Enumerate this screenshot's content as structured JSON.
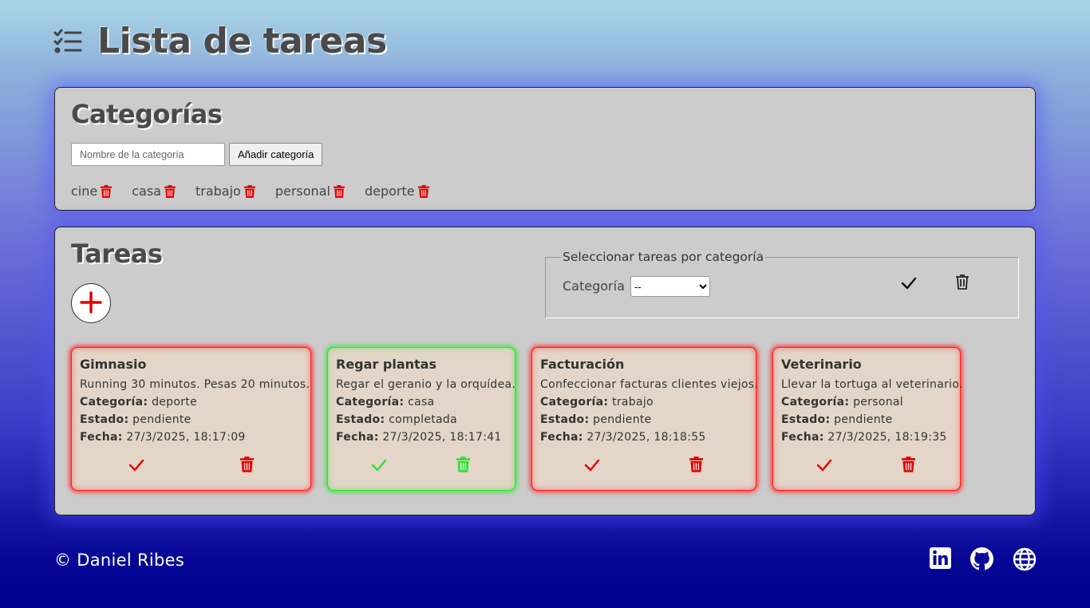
{
  "app": {
    "title": "Lista de tareas",
    "icon": "task-list-icon"
  },
  "categories_panel": {
    "title": "Categorías",
    "input_placeholder": "Nombre de la categoría",
    "add_button": "Añadir categoría",
    "items": [
      {
        "label": "cine"
      },
      {
        "label": "casa"
      },
      {
        "label": "trabajo"
      },
      {
        "label": "personal"
      },
      {
        "label": "deporte"
      }
    ],
    "trash_icon": "trash-icon",
    "trash_color": "#e30000"
  },
  "tasks_panel": {
    "title": "Tareas",
    "add_icon": "plus-icon",
    "filter": {
      "legend": "Seleccionar tareas por categoría",
      "label": "Categoría",
      "selected": "--",
      "check_icon": "check-icon",
      "trash_icon": "trash-icon"
    },
    "field_labels": {
      "category": "Categoría:",
      "status": "Estado:",
      "date": "Fecha:"
    },
    "tasks": [
      {
        "title": "Gimnasio",
        "description": "Running 30 minutos. Pesas 20 minutos.",
        "category": "deporte",
        "status": "pendiente",
        "date": "27/3/2025, 18:17:09"
      },
      {
        "title": "Regar plantas",
        "description": "Regar el geranio y la orquídea.",
        "category": "casa",
        "status": "completada",
        "date": "27/3/2025, 18:17:41"
      },
      {
        "title": "Facturación",
        "description": "Confeccionar facturas clientes viejos.",
        "category": "trabajo",
        "status": "pendiente",
        "date": "27/3/2025, 18:18:55"
      },
      {
        "title": "Veterinario",
        "description": "Llevar la tortuga al veterinario.",
        "category": "personal",
        "status": "pendiente",
        "date": "27/3/2025, 18:19:35"
      }
    ],
    "colors": {
      "pending": "#e30000",
      "done": "#33dd33"
    }
  },
  "footer": {
    "copyright": "© Daniel Ribes",
    "links": [
      {
        "icon": "linkedin-icon"
      },
      {
        "icon": "github-icon"
      },
      {
        "icon": "globe-icon"
      }
    ]
  }
}
